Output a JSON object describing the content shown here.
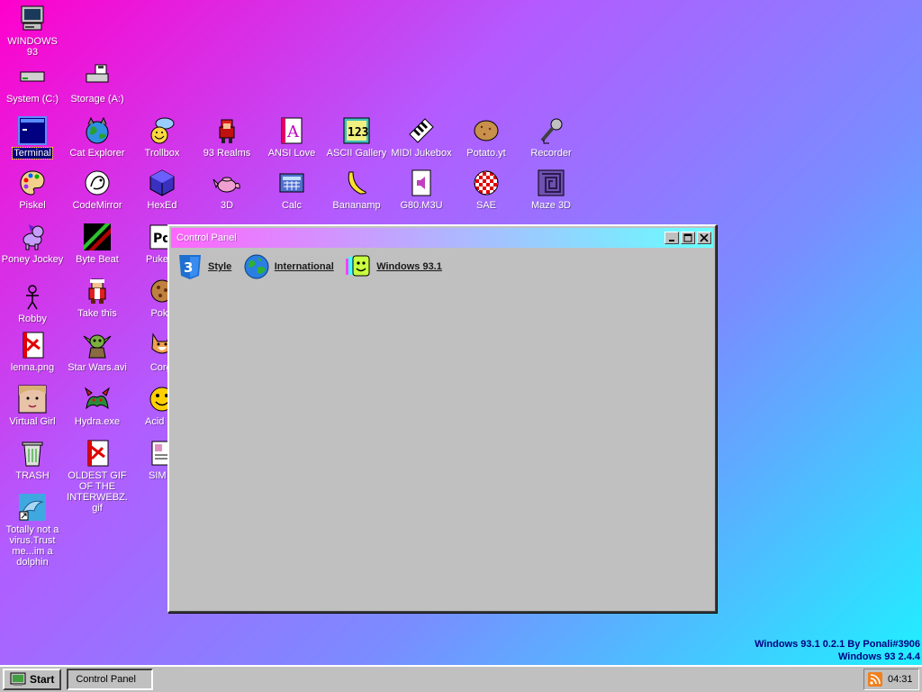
{
  "desktop": {
    "background": [
      "#ff00cc",
      "#b25cff",
      "#1ff0ff"
    ],
    "icons": [
      {
        "label": "WINDOWS 93",
        "icon": "computer-icon"
      },
      {
        "label": "System (C:)",
        "icon": "drive-icon"
      },
      {
        "label": "Storage (A:)",
        "icon": "storage-icon"
      },
      {
        "label": "Terminal",
        "icon": "terminal-icon"
      },
      {
        "label": "Cat Explorer",
        "icon": "cat-globe-icon"
      },
      {
        "label": "Trollbox",
        "icon": "trollbox-icon"
      },
      {
        "label": "93 Realms",
        "icon": "realms-icon"
      },
      {
        "label": "ANSI Love",
        "icon": "ansi-icon"
      },
      {
        "label": "ASCII Gallery",
        "icon": "ascii-gallery-icon"
      },
      {
        "label": "MIDI Jukebox",
        "icon": "piano-icon"
      },
      {
        "label": "Potato.yt",
        "icon": "potato-icon"
      },
      {
        "label": "Recorder",
        "icon": "microphone-icon"
      },
      {
        "label": "Piskel",
        "icon": "palette-icon"
      },
      {
        "label": "CodeMirror",
        "icon": "codemirror-icon"
      },
      {
        "label": "HexEd",
        "icon": "cube-icon"
      },
      {
        "label": "3D",
        "icon": "teapot-icon"
      },
      {
        "label": "Calc",
        "icon": "calculator-icon"
      },
      {
        "label": "Bananamp",
        "icon": "banana-icon"
      },
      {
        "label": "G80.M3U",
        "icon": "audio-file-icon"
      },
      {
        "label": "SAE",
        "icon": "checker-ball-icon"
      },
      {
        "label": "Maze 3D",
        "icon": "maze-icon"
      },
      {
        "label": "Poney Jockey",
        "icon": "pony-icon"
      },
      {
        "label": "Byte Beat",
        "icon": "bytebeat-icon"
      },
      {
        "label": "Puke D",
        "icon": "puredata-icon"
      },
      {
        "label": "Robby",
        "icon": "stickman-icon"
      },
      {
        "label": "Take this",
        "icon": "take-this-icon"
      },
      {
        "label": "Poké",
        "icon": "cookie-icon"
      },
      {
        "label": "lenna.png",
        "icon": "image-file-icon"
      },
      {
        "label": "Star Wars.avi",
        "icon": "yoda-icon"
      },
      {
        "label": "Corgi",
        "icon": "corgi-icon"
      },
      {
        "label": "Virtual Girl",
        "icon": "face-icon"
      },
      {
        "label": "Hydra.exe",
        "icon": "hydra-icon"
      },
      {
        "label": "Acid Bo",
        "icon": "smiley-icon"
      },
      {
        "label": "TRASH",
        "icon": "trash-icon"
      },
      {
        "label": "OLDEST GIF OF THE INTERWEBZ.gif",
        "icon": "gif-file-icon"
      },
      {
        "label": "SIM S",
        "icon": "sim-icon"
      },
      {
        "label": "Totally not a virus.Trust me...im a dolphin",
        "icon": "dolphin-icon"
      }
    ]
  },
  "window": {
    "title": "Control Panel",
    "items": [
      {
        "label": "Style",
        "icon": "css3-icon"
      },
      {
        "label": "International",
        "icon": "globe-icon"
      },
      {
        "label": "Windows 93.1",
        "icon": "windows93-icon"
      }
    ]
  },
  "version": {
    "line1": "Windows 93.1 0.2.1 By Ponali#3906",
    "line2": "Windows 93 2.4.4"
  },
  "taskbar": {
    "start_label": "Start",
    "task_label": "Control Panel",
    "clock": "04:31"
  }
}
